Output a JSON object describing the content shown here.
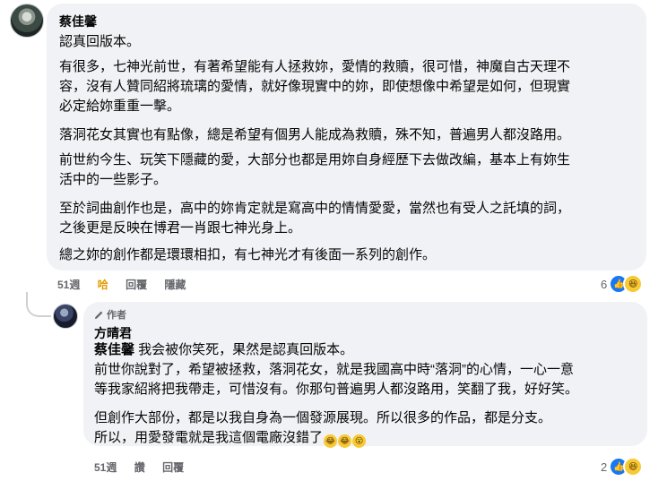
{
  "comment": {
    "author": "蔡佳馨",
    "paragraphs": [
      "認真回版本。",
      "有很多，七神光前世，有著希望能有人拯救妳，愛情的救贖，很可惜，神魔自古天理不\n容，沒有人贊同紹將琉璃的愛情，就好像現實中的妳，即使想像中希望是如何，但現實\n必定給妳重重一擊。",
      "落洞花女其實也有點像，總是希望有個男人能成為救贖，殊不知，普遍男人都沒路用。",
      "前世約今生、玩笑下隱藏的愛，大部分也都是用妳自身經歷下去做改編，基本上有妳生\n活中的一些影子。",
      "至於詞曲創作也是，高中的妳肯定就是寫高中的情情愛愛，當然也有受人之託填的詞，\n之後更是反映在博君一肖跟七神光身上。",
      "總之妳的創作都是環環相扣，有七神光才有後面一系列的創作。"
    ],
    "actions": {
      "time": "51週",
      "like": "哈",
      "reply": "回覆",
      "hide": "隱藏"
    },
    "reaction_count": "6"
  },
  "reply": {
    "badge": "作者",
    "author": "方晴君",
    "mention": "蔡佳馨",
    "first_line": " 我会被你笑死，果然是認真回版本。",
    "paragraphs": [
      "前世你說對了，希望被拯救，落洞花女，就是我國高中時“落洞”的心情，一心一意\n等我家紹將把我帶走，可惜沒有。你那句普遍男人都沒路用，笑翻了我，好好笑。",
      "但創作大部份，都是以我自身為一個發源展現。所以很多的作品，都是分支。\n所以，用愛發電就是我這個電廠沒錯了"
    ],
    "actions": {
      "time": "51週",
      "like": "讚",
      "reply": "回覆"
    },
    "reaction_count": "2"
  },
  "icons": {
    "like": "like-icon",
    "haha": "haha-icon",
    "pencil": "pencil-icon"
  },
  "colors": {
    "bubble": "#f0f2f5",
    "like_blue": "#1877f2",
    "haha_yellow": "#f7c934",
    "muted": "#65676b",
    "liked_label": "#e59c00"
  }
}
